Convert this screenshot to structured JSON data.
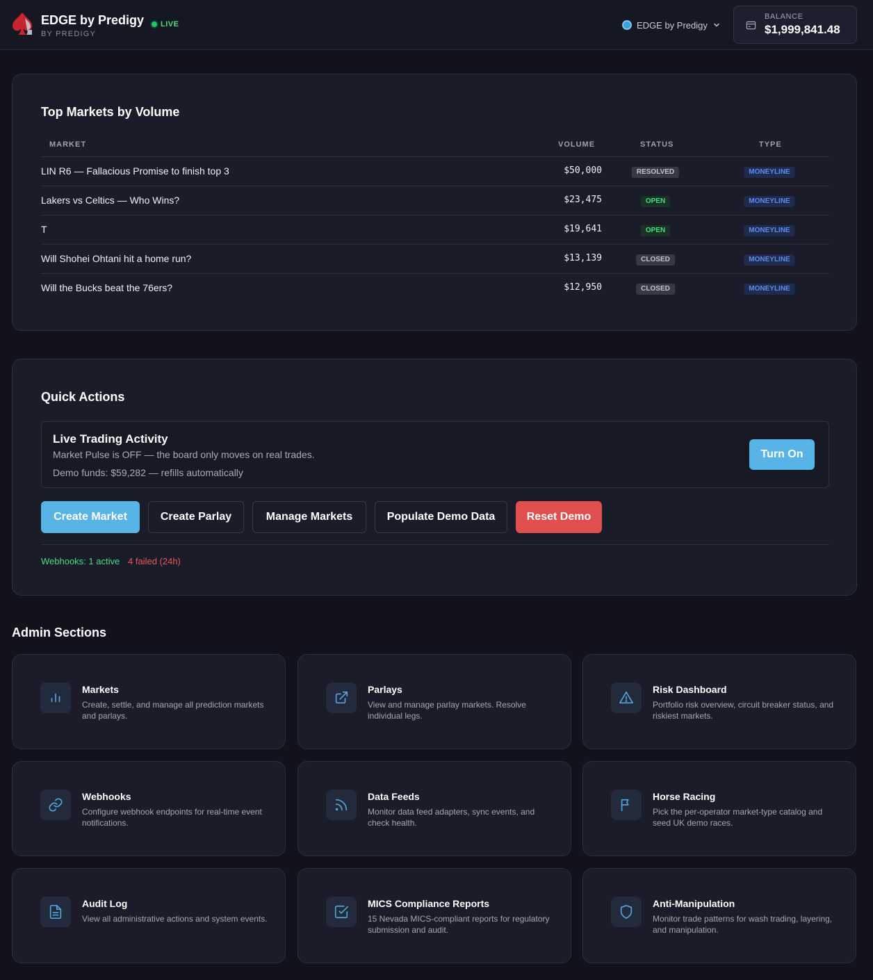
{
  "header": {
    "brand_title": "EDGE by Predigy",
    "brand_sub": "BY PREDIGY",
    "live_label": "LIVE",
    "operator_label": "EDGE by Predigy",
    "balance_label": "BALANCE",
    "balance_value": "$1,999,841.48"
  },
  "top_markets": {
    "title": "Top Markets by Volume",
    "columns": {
      "market": "MARKET",
      "volume": "VOLUME",
      "status": "STATUS",
      "type": "TYPE"
    },
    "rows": [
      {
        "market": "LIN R6 — Fallacious Promise to finish top 3",
        "volume": "$50,000",
        "status": "RESOLVED",
        "type": "MONEYLINE"
      },
      {
        "market": "Lakers vs Celtics — Who Wins?",
        "volume": "$23,475",
        "status": "OPEN",
        "type": "MONEYLINE"
      },
      {
        "market": "T",
        "volume": "$19,641",
        "status": "OPEN",
        "type": "MONEYLINE"
      },
      {
        "market": "Will Shohei Ohtani hit a home run?",
        "volume": "$13,139",
        "status": "CLOSED",
        "type": "MONEYLINE"
      },
      {
        "market": "Will the Bucks beat the 76ers?",
        "volume": "$12,950",
        "status": "CLOSED",
        "type": "MONEYLINE"
      }
    ]
  },
  "quick_actions": {
    "title": "Quick Actions",
    "pulse_title": "Live Trading Activity",
    "pulse_desc": "Market Pulse is OFF — the board only moves on real trades.",
    "pulse_funds": "Demo funds: $59,282 — refills automatically",
    "turn_on_label": "Turn On",
    "buttons": {
      "create_market": "Create Market",
      "create_parlay": "Create Parlay",
      "manage_markets": "Manage Markets",
      "populate_demo": "Populate Demo Data",
      "reset_demo": "Reset Demo"
    },
    "webhooks_active": "Webhooks: 1 active",
    "webhooks_failed": "4 failed (24h)"
  },
  "admin": {
    "title": "Admin Sections",
    "cards": [
      {
        "icon": "bar-chart-icon",
        "title": "Markets",
        "desc": "Create, settle, and manage all prediction markets and parlays."
      },
      {
        "icon": "external-link-icon",
        "title": "Parlays",
        "desc": "View and manage parlay markets. Resolve individual legs."
      },
      {
        "icon": "warning-triangle-icon",
        "title": "Risk Dashboard",
        "desc": "Portfolio risk overview, circuit breaker status, and riskiest markets."
      },
      {
        "icon": "link-icon",
        "title": "Webhooks",
        "desc": "Configure webhook endpoints for real-time event notifications."
      },
      {
        "icon": "rss-feed-icon",
        "title": "Data Feeds",
        "desc": "Monitor data feed adapters, sync events, and check health."
      },
      {
        "icon": "flag-icon",
        "title": "Horse Racing",
        "desc": "Pick the per-operator market-type catalog and seed UK demo races."
      },
      {
        "icon": "document-icon",
        "title": "Audit Log",
        "desc": "View all administrative actions and system events."
      },
      {
        "icon": "checkbox-icon",
        "title": "MICS Compliance Reports",
        "desc": "15 Nevada MICS-compliant reports for regulatory submission and audit."
      },
      {
        "icon": "shield-icon",
        "title": "Anti-Manipulation",
        "desc": "Monitor trade patterns for wash trading, layering, and manipulation."
      }
    ]
  },
  "colors": {
    "accent": "#58b4e6",
    "danger": "#e04e4e",
    "success": "#4ade80",
    "background": "#11121b"
  }
}
